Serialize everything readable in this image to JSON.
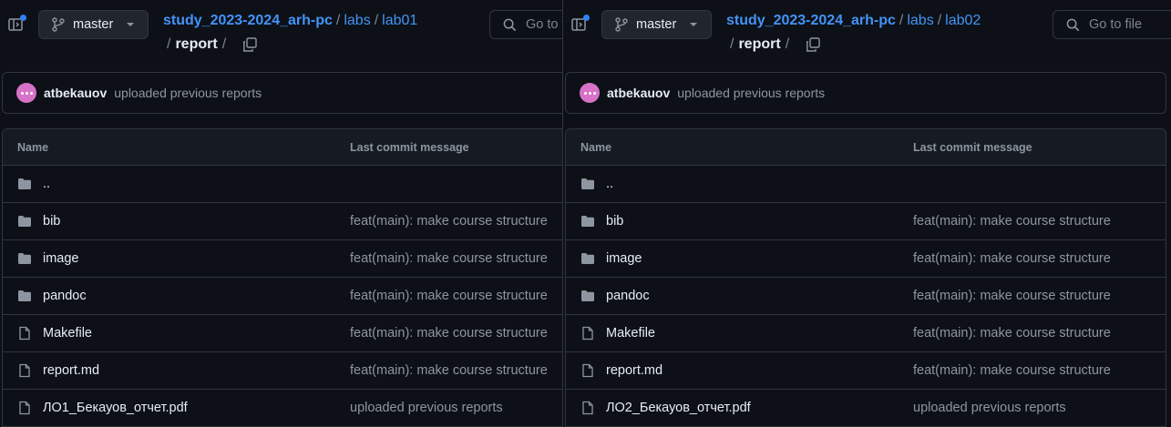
{
  "colors": {
    "bg": "#0d1117",
    "border": "#30363d",
    "link": "#4493f8",
    "muted": "#8d96a0",
    "icon": "#8d96a0",
    "avatar": "#d772c7"
  },
  "panes": [
    {
      "branch": "master",
      "crumbs": {
        "repo": "study_2023-2024_arh-pc",
        "dir1": "labs",
        "dir2": "lab01",
        "current": "report"
      },
      "goto_label": "Go to file",
      "commit": {
        "author": "atbekauov",
        "message": "uploaded previous reports"
      },
      "table": {
        "col_name": "Name",
        "col_msg": "Last commit message",
        "rows": [
          {
            "icon": "folder-icon",
            "name": "..",
            "msg": ""
          },
          {
            "icon": "folder-icon",
            "name": "bib",
            "msg": "feat(main): make course structure"
          },
          {
            "icon": "folder-icon",
            "name": "image",
            "msg": "feat(main): make course structure"
          },
          {
            "icon": "folder-icon",
            "name": "pandoc",
            "msg": "feat(main): make course structure"
          },
          {
            "icon": "file-icon",
            "name": "Makefile",
            "msg": "feat(main): make course structure"
          },
          {
            "icon": "file-icon",
            "name": "report.md",
            "msg": "feat(main): make course structure"
          },
          {
            "icon": "file-icon",
            "name": "ЛО1_Бекауов_отчет.pdf",
            "msg": "uploaded previous reports"
          }
        ]
      }
    },
    {
      "branch": "master",
      "crumbs": {
        "repo": "study_2023-2024_arh-pc",
        "dir1": "labs",
        "dir2": "lab02",
        "current": "report"
      },
      "goto_label": "Go to file",
      "commit": {
        "author": "atbekauov",
        "message": "uploaded previous reports"
      },
      "table": {
        "col_name": "Name",
        "col_msg": "Last commit message",
        "rows": [
          {
            "icon": "folder-icon",
            "name": "..",
            "msg": ""
          },
          {
            "icon": "folder-icon",
            "name": "bib",
            "msg": "feat(main): make course structure"
          },
          {
            "icon": "folder-icon",
            "name": "image",
            "msg": "feat(main): make course structure"
          },
          {
            "icon": "folder-icon",
            "name": "pandoc",
            "msg": "feat(main): make course structure"
          },
          {
            "icon": "file-icon",
            "name": "Makefile",
            "msg": "feat(main): make course structure"
          },
          {
            "icon": "file-icon",
            "name": "report.md",
            "msg": "feat(main): make course structure"
          },
          {
            "icon": "file-icon",
            "name": "ЛО2_Бекауов_отчет.pdf",
            "msg": "uploaded previous reports"
          }
        ]
      }
    }
  ]
}
